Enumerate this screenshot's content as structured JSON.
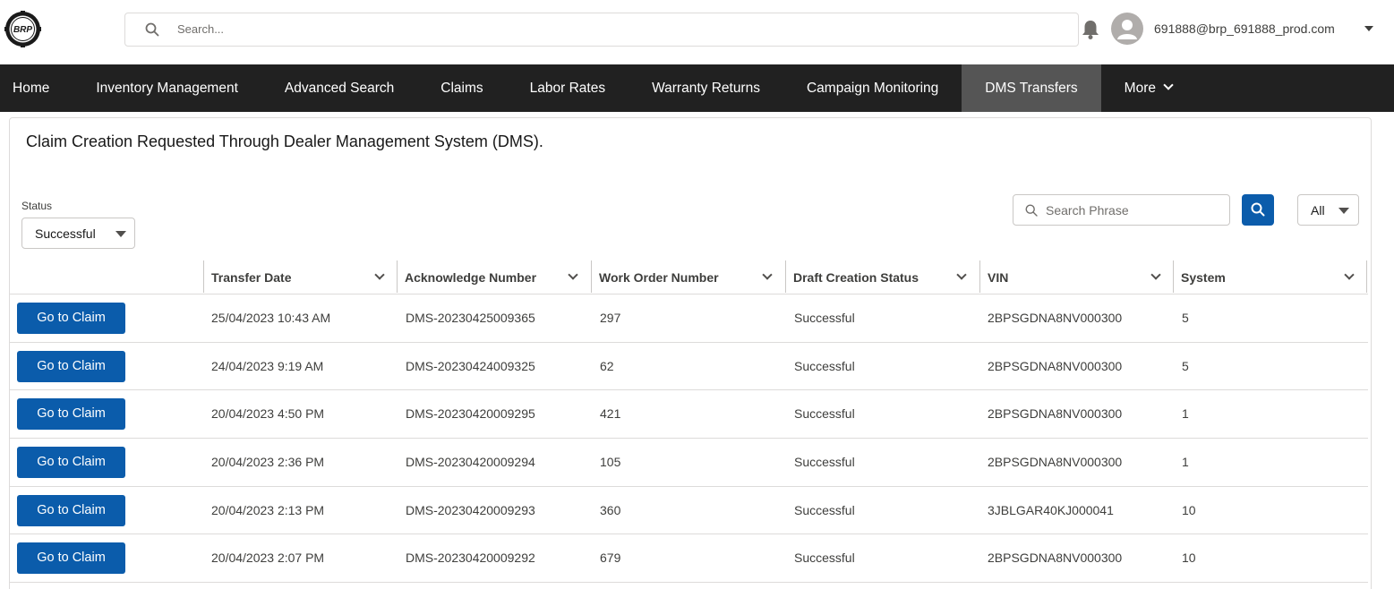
{
  "header": {
    "search_placeholder": "Search...",
    "user_email": "691888@brp_691888_prod.com",
    "logo_text": "BRP"
  },
  "nav": {
    "items": [
      {
        "label": "Home",
        "active": false
      },
      {
        "label": "Inventory Management",
        "active": false
      },
      {
        "label": "Advanced Search",
        "active": false
      },
      {
        "label": "Claims",
        "active": false
      },
      {
        "label": "Labor Rates",
        "active": false
      },
      {
        "label": "Warranty Returns",
        "active": false
      },
      {
        "label": "Campaign Monitoring",
        "active": false
      },
      {
        "label": "DMS Transfers",
        "active": true
      },
      {
        "label": "More",
        "active": false
      }
    ]
  },
  "page": {
    "title": "Claim Creation Requested Through Dealer Management System (DMS).",
    "status_label": "Status",
    "status_value": "Successful",
    "search_phrase_placeholder": "Search Phrase",
    "filter_value": "All"
  },
  "table": {
    "columns": [
      "Transfer Date",
      "Acknowledge Number",
      "Work Order Number",
      "Draft Creation Status",
      "VIN",
      "System"
    ],
    "button_label": "Go to Claim",
    "rows": [
      [
        "25/04/2023 10:43 AM",
        "DMS-20230425009365",
        "297",
        "Successful",
        "2BPSGDNA8NV000300",
        "5"
      ],
      [
        "24/04/2023 9:19 AM",
        "DMS-20230424009325",
        "62",
        "Successful",
        "2BPSGDNA8NV000300",
        "5"
      ],
      [
        "20/04/2023 4:50 PM",
        "DMS-20230420009295",
        "421",
        "Successful",
        "2BPSGDNA8NV000300",
        "1"
      ],
      [
        "20/04/2023 2:36 PM",
        "DMS-20230420009294",
        "105",
        "Successful",
        "2BPSGDNA8NV000300",
        "1"
      ],
      [
        "20/04/2023 2:13 PM",
        "DMS-20230420009293",
        "360",
        "Successful",
        "3JBLGAR40KJ000041",
        "10"
      ],
      [
        "20/04/2023 2:07 PM",
        "DMS-20230420009292",
        "679",
        "Successful",
        "2BPSGDNA8NV000300",
        "10"
      ]
    ]
  },
  "colors": {
    "nav_bg": "#212121",
    "nav_active_bg": "#555555",
    "brand_blue": "#0b5cab"
  }
}
